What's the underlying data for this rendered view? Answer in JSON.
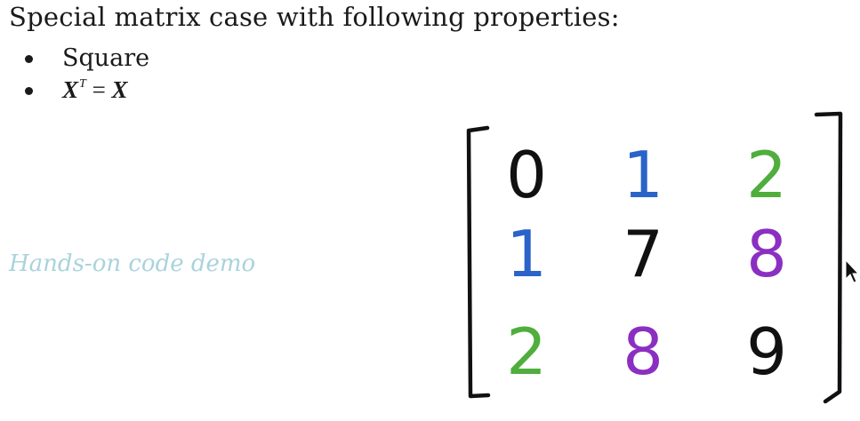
{
  "heading": "Special matrix case with following properties:",
  "bullets": {
    "square": "Square",
    "symmetry": {
      "base": "X",
      "superscript": "T",
      "equals": "=",
      "rhs": "X"
    }
  },
  "demo_link": "Hands-on code demo",
  "matrix": {
    "rows": [
      [
        {
          "value": "0",
          "color": "#111111"
        },
        {
          "value": "1",
          "color": "#2a63c9"
        },
        {
          "value": "2",
          "color": "#4fae3c"
        }
      ],
      [
        {
          "value": "1",
          "color": "#2a63c9"
        },
        {
          "value": "7",
          "color": "#111111"
        },
        {
          "value": "8",
          "color": "#8b2fc2"
        }
      ],
      [
        {
          "value": "2",
          "color": "#4fae3c"
        },
        {
          "value": "8",
          "color": "#8b2fc2"
        },
        {
          "value": "9",
          "color": "#111111"
        }
      ]
    ]
  },
  "colors": {
    "text": "#1a1a1a",
    "demo_link": "#a9d3dc",
    "black_ink": "#111111",
    "blue_ink": "#2a63c9",
    "green_ink": "#4fae3c",
    "purple_ink": "#8b2fc2"
  }
}
